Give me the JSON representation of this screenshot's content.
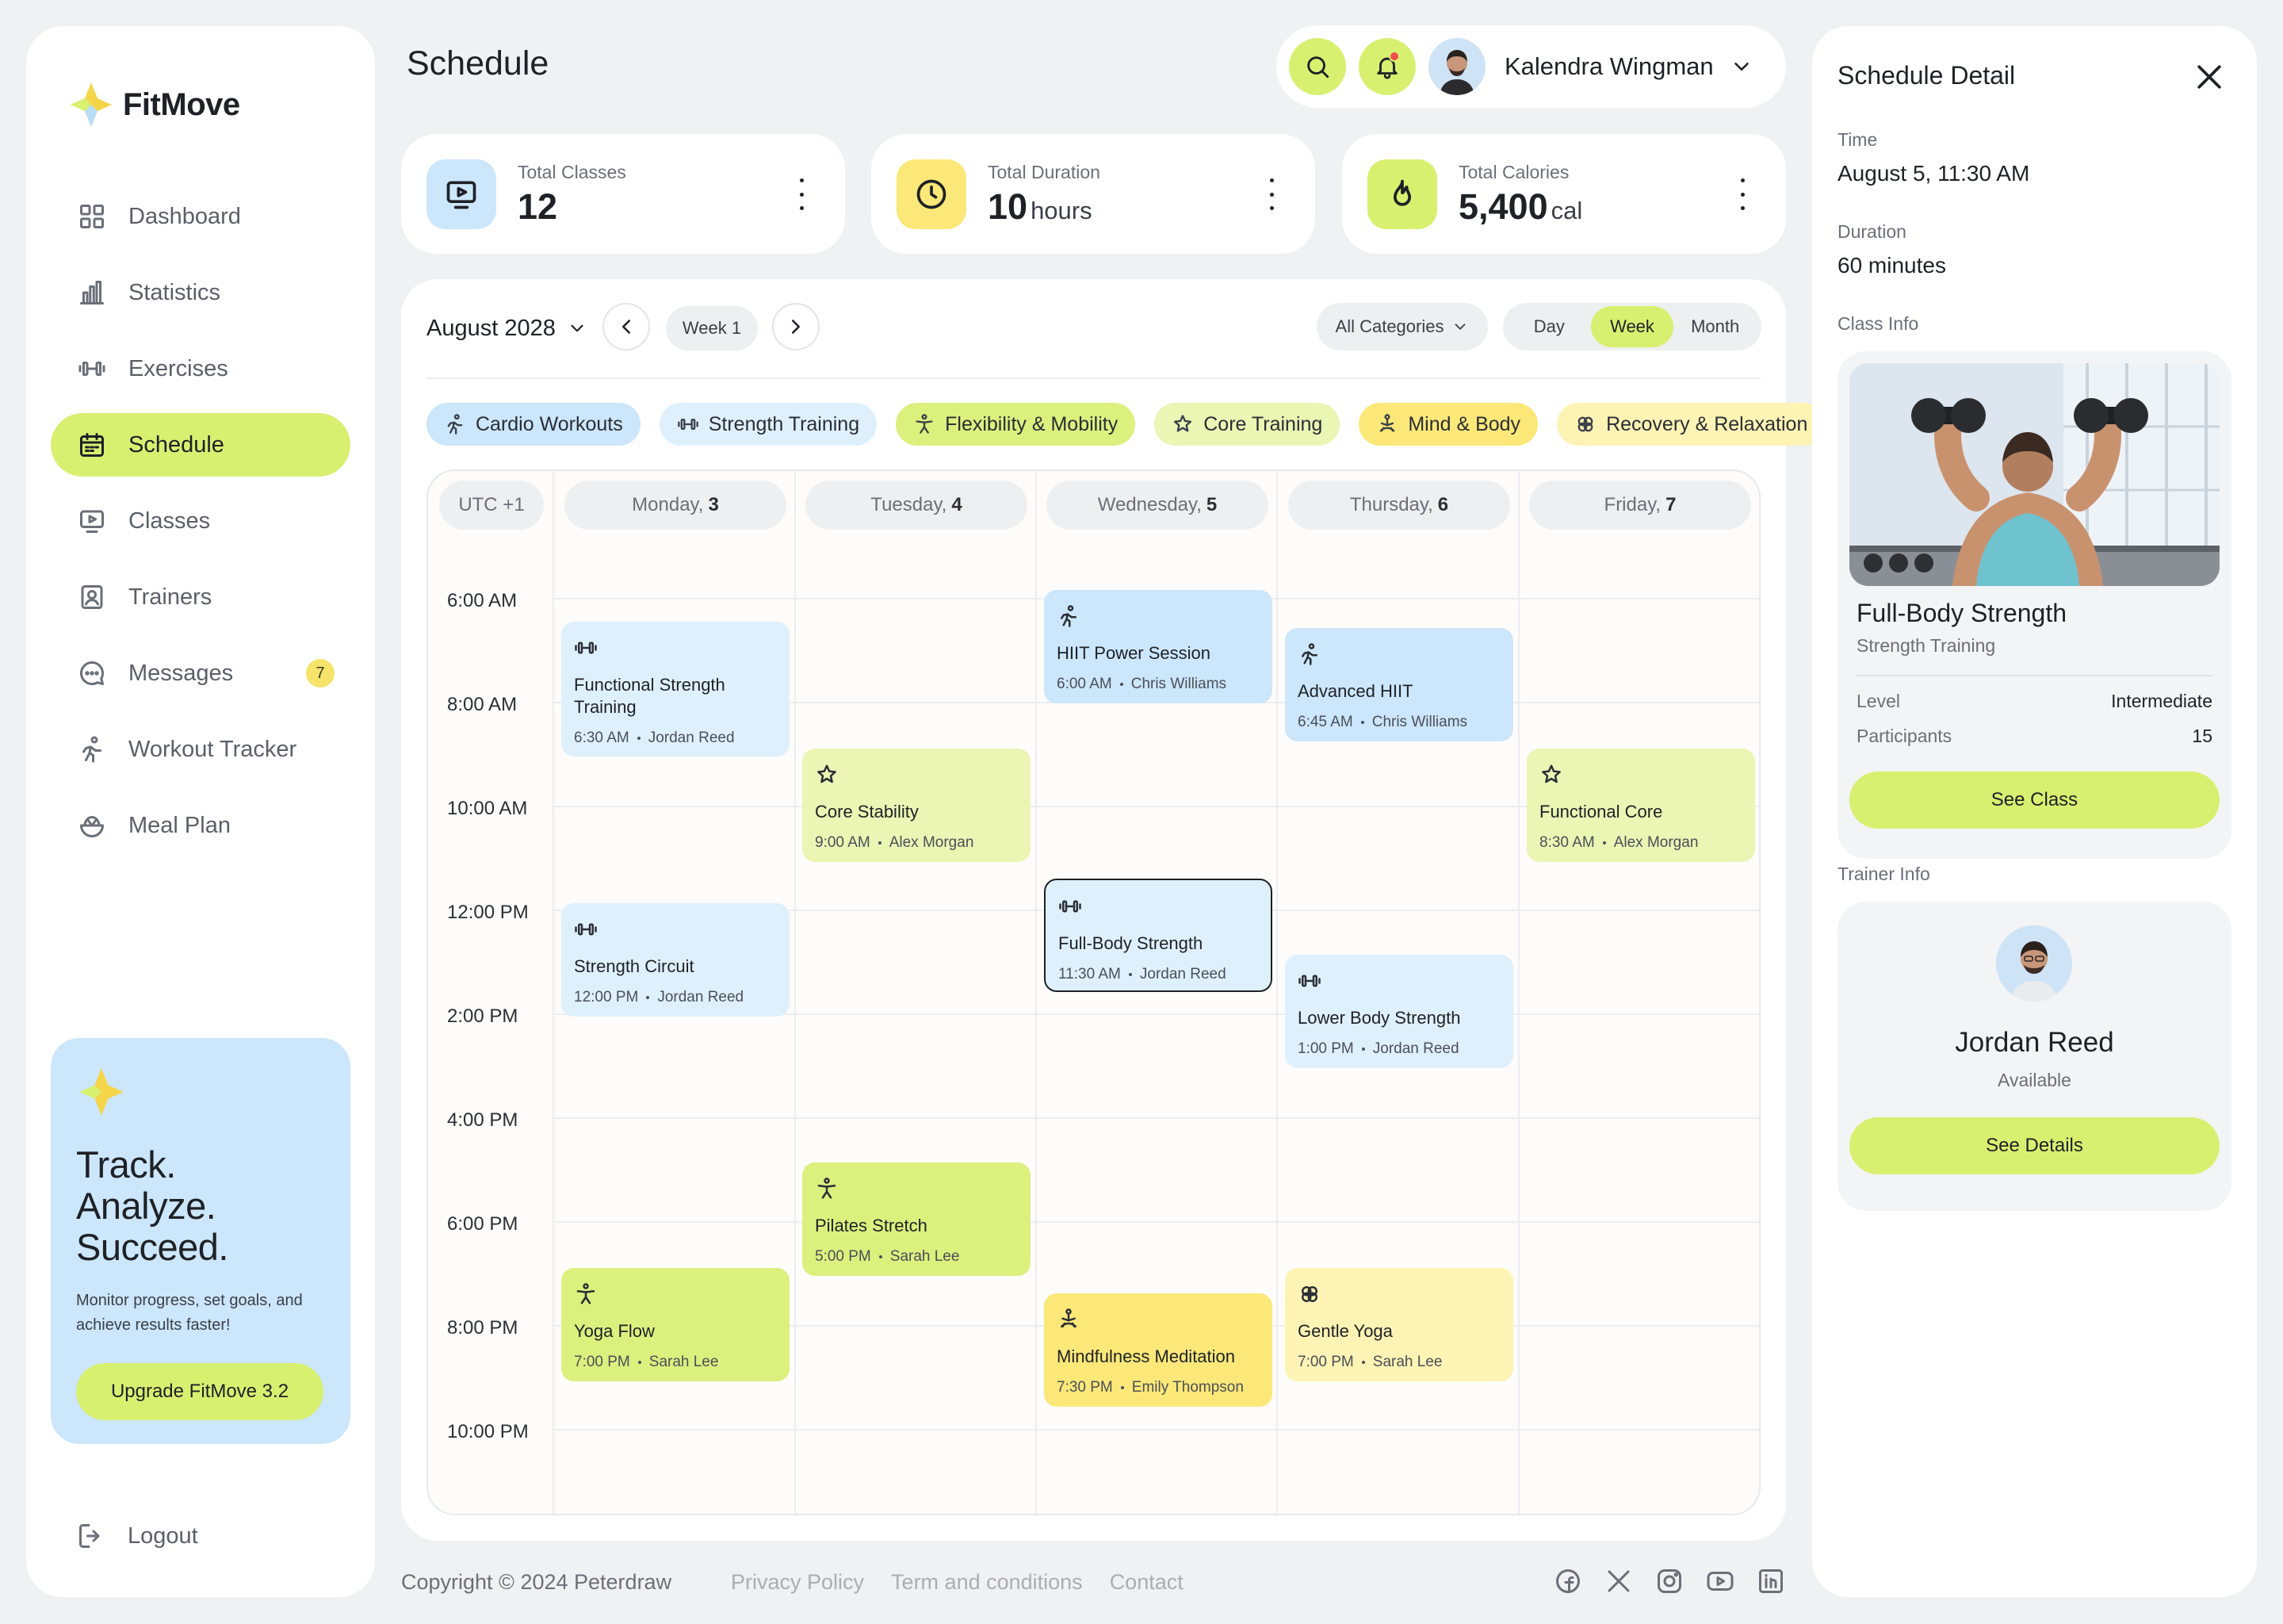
{
  "brand": {
    "name": "FitMove"
  },
  "nav": {
    "items": [
      {
        "label": "Dashboard",
        "icon": "grid-icon"
      },
      {
        "label": "Statistics",
        "icon": "bar-chart-icon"
      },
      {
        "label": "Exercises",
        "icon": "dumbbell-icon"
      },
      {
        "label": "Schedule",
        "icon": "calendar-icon",
        "active": true
      },
      {
        "label": "Classes",
        "icon": "play-screen-icon"
      },
      {
        "label": "Trainers",
        "icon": "id-card-icon"
      },
      {
        "label": "Messages",
        "icon": "chat-icon",
        "badge": "7"
      },
      {
        "label": "Workout Tracker",
        "icon": "running-icon"
      },
      {
        "label": "Meal Plan",
        "icon": "bowl-icon"
      }
    ],
    "logout": "Logout"
  },
  "promo": {
    "line1": "Track.",
    "line2": "Analyze.",
    "line3": "Succeed.",
    "desc": "Monitor progress, set goals, and achieve results faster!",
    "button": "Upgrade FitMove 3.2"
  },
  "header": {
    "title": "Schedule",
    "user_name": "Kalendra Wingman"
  },
  "stats": [
    {
      "label": "Total Classes",
      "value": "12",
      "unit": "",
      "icon": "play-screen-icon",
      "color": "#cce6fb"
    },
    {
      "label": "Total Duration",
      "value": "10",
      "unit": "hours",
      "icon": "clock-icon",
      "color": "#fbe878"
    },
    {
      "label": "Total Calories",
      "value": "5,400",
      "unit": "cal",
      "icon": "flame-icon",
      "color": "#d8f070"
    }
  ],
  "calendar": {
    "month": "August 2028",
    "week": "Week 1",
    "category_filter": "All Categories",
    "views": [
      "Day",
      "Week",
      "Month"
    ],
    "active_view": "Week",
    "timezone": "UTC +1",
    "days": [
      {
        "name": "Monday,",
        "num": "3"
      },
      {
        "name": "Tuesday,",
        "num": "4"
      },
      {
        "name": "Wednesday,",
        "num": "5"
      },
      {
        "name": "Thursday,",
        "num": "6"
      },
      {
        "name": "Friday,",
        "num": "7"
      }
    ],
    "times": [
      "6:00 AM",
      "8:00 AM",
      "10:00 AM",
      "12:00 PM",
      "2:00 PM",
      "4:00 PM",
      "6:00 PM",
      "8:00 PM",
      "10:00 PM"
    ],
    "categories": [
      {
        "label": "Cardio Workouts",
        "icon": "running-icon",
        "color": "#cce6fb"
      },
      {
        "label": "Strength Training",
        "icon": "dumbbell-icon",
        "color": "#dff0fd"
      },
      {
        "label": "Flexibility & Mobility",
        "icon": "stretch-icon",
        "color": "#dcf07e"
      },
      {
        "label": "Core Training",
        "icon": "star-person-icon",
        "color": "#ebf5b4"
      },
      {
        "label": "Mind & Body",
        "icon": "meditation-icon",
        "color": "#fbe878"
      },
      {
        "label": "Recovery & Relaxation",
        "icon": "clover-icon",
        "color": "#fdf3b4"
      }
    ],
    "events": [
      {
        "title": "Functional Strength Training",
        "time": "6:30 AM",
        "trainer": "Jordan Reed",
        "icon": "dumbbell-icon",
        "style": "ev-lightblue"
      },
      {
        "title": "Strength Circuit",
        "time": "12:00 PM",
        "trainer": "Jordan Reed",
        "icon": "dumbbell-icon",
        "style": "ev-lightblue"
      },
      {
        "title": "Yoga Flow",
        "time": "7:00 PM",
        "trainer": "Sarah Lee",
        "icon": "stretch-icon",
        "style": "ev-lime"
      },
      {
        "title": "Core Stability",
        "time": "9:00 AM",
        "trainer": "Alex Morgan",
        "icon": "star-person-icon",
        "style": "ev-palelime"
      },
      {
        "title": "Pilates Stretch",
        "time": "5:00 PM",
        "trainer": "Sarah Lee",
        "icon": "stretch-icon",
        "style": "ev-lime"
      },
      {
        "title": "HIIT Power Session",
        "time": "6:00 AM",
        "trainer": "Chris Williams",
        "icon": "running-icon",
        "style": "ev-blue"
      },
      {
        "title": "Full-Body Strength",
        "time": "11:30 AM",
        "trainer": "Jordan Reed",
        "icon": "dumbbell-icon",
        "style": "ev-lightblue ev-selected"
      },
      {
        "title": "Mindfulness Meditation",
        "time": "7:30 PM",
        "trainer": "Emily Thompson",
        "icon": "meditation-icon",
        "style": "ev-yellow"
      },
      {
        "title": "Advanced HIIT",
        "time": "6:45 AM",
        "trainer": "Chris Williams",
        "icon": "running-icon",
        "style": "ev-blue"
      },
      {
        "title": "Lower Body Strength",
        "time": "1:00 PM",
        "trainer": "Jordan Reed",
        "icon": "dumbbell-icon",
        "style": "ev-lightblue"
      },
      {
        "title": "Gentle Yoga",
        "time": "7:00 PM",
        "trainer": "Sarah Lee",
        "icon": "clover-icon",
        "style": "ev-paleyellow"
      },
      {
        "title": "Functional Core",
        "time": "8:30 AM",
        "trainer": "Alex Morgan",
        "icon": "star-person-icon",
        "style": "ev-palelime"
      }
    ]
  },
  "footer": {
    "copyright": "Copyright © 2024 Peterdraw",
    "links": [
      "Privacy Policy",
      "Term and conditions",
      "Contact"
    ]
  },
  "detail": {
    "title": "Schedule Detail",
    "time_label": "Time",
    "time_value": "August 5, 11:30 AM",
    "duration_label": "Duration",
    "duration_value": "60 minutes",
    "class_info_label": "Class Info",
    "class_name": "Full-Body Strength",
    "class_category": "Strength Training",
    "level_label": "Level",
    "level_value": "Intermediate",
    "participants_label": "Participants",
    "participants_value": "15",
    "see_class": "See Class",
    "trainer_info_label": "Trainer Info",
    "trainer_name": "Jordan Reed",
    "trainer_status": "Available",
    "see_details": "See Details"
  }
}
